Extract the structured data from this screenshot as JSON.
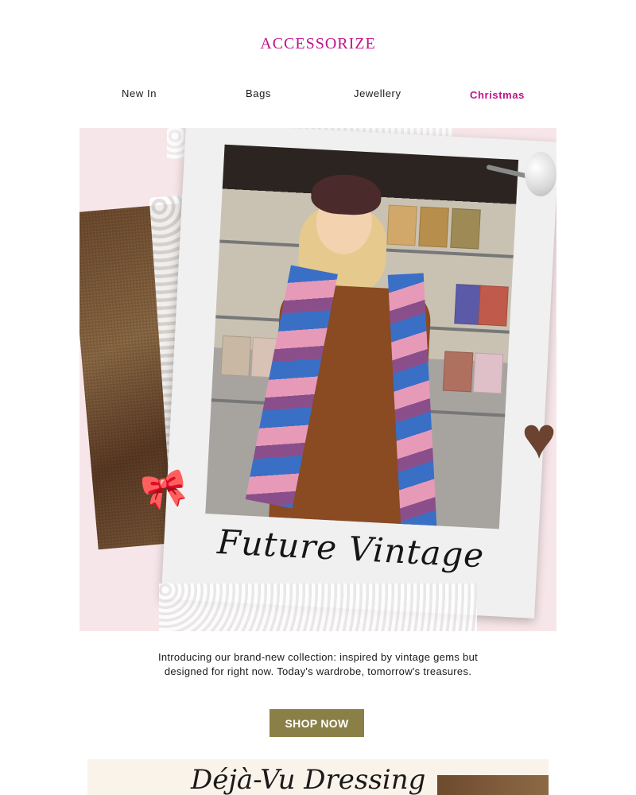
{
  "brand": {
    "logo": "ACCESSORIZE",
    "brand_color": "#c0138a"
  },
  "nav": {
    "items": [
      {
        "label": "New In"
      },
      {
        "label": "Bags"
      },
      {
        "label": "Jewellery"
      },
      {
        "label": "Christmas"
      }
    ]
  },
  "hero": {
    "script_title": "Future Vintage",
    "icons": [
      "pearl-icon",
      "heart-icon",
      "bow-icon"
    ]
  },
  "intro": {
    "text": "Introducing our brand-new collection: inspired by vintage gems but designed for right now. Today's wardrobe, tomorrow's treasures."
  },
  "cta": {
    "label": "SHOP NOW",
    "color": "#8b7f48"
  },
  "next_section": {
    "title": "Déjà-Vu Dressing"
  }
}
